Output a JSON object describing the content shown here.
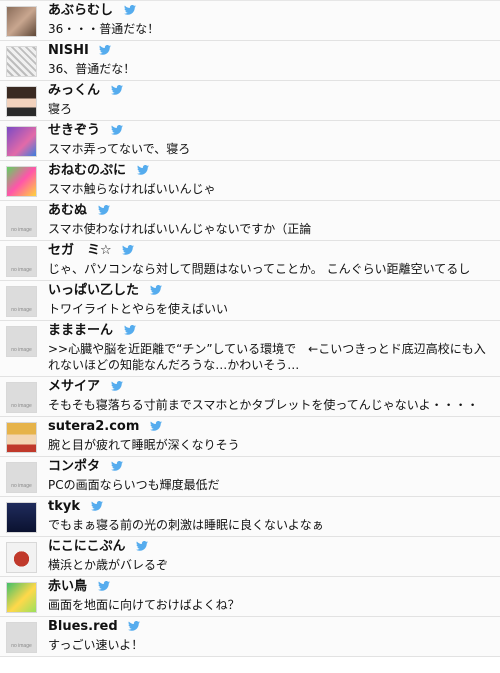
{
  "colors": {
    "bird": "#55acee"
  },
  "no_image_label": "no image",
  "comments": [
    {
      "name": "あぶらむし",
      "text": "36・・・普通だな！",
      "avatar": "a1"
    },
    {
      "name": "NISHI",
      "text": "36、普通だな！",
      "avatar": "a2"
    },
    {
      "name": "みっくん",
      "text": "寝ろ",
      "avatar": "a3"
    },
    {
      "name": "せきぞう",
      "text": "スマホ弄ってないで、寝ろ",
      "avatar": "a4"
    },
    {
      "name": "おねむのぷに",
      "text": "スマホ触らなければいいんじゃ",
      "avatar": "a5"
    },
    {
      "name": "あむぬ",
      "text": "スマホ使わなければいいんじゃないですか（正論",
      "avatar": "noimg"
    },
    {
      "name": "セガ　ミ☆",
      "text": "じゃ、パソコンなら対して問題はないってことか。 こんぐらい距離空いてるし",
      "avatar": "noimg"
    },
    {
      "name": "いっぱい乙した",
      "text": "トワイライトとやらを使えばいい",
      "avatar": "noimg"
    },
    {
      "name": "まままーん",
      "text": ">>心臓や脳を近距離で“チン”している環境で　←こいつきっとド底辺高校にも入れないほどの知能なんだろうな…かわいそう…",
      "avatar": "noimg",
      "tall": true
    },
    {
      "name": "メサイア",
      "text": "そもそも寝落ちる寸前までスマホとかタブレットを使ってんじゃないよ・・・・",
      "avatar": "noimg"
    },
    {
      "name": "sutera2.com",
      "text": "腕と目が疲れて睡眠が深くなりそう",
      "avatar": "a6"
    },
    {
      "name": "コンポタ",
      "text": "PCの画面ならいつも輝度最低だ",
      "avatar": "noimg"
    },
    {
      "name": "tkyk",
      "text": "でもまぁ寝る前の光の刺激は睡眠に良くないよなぁ",
      "avatar": "a7"
    },
    {
      "name": "にこにこぷん",
      "text": "横浜とか歳がバレるぞ",
      "avatar": "a8"
    },
    {
      "name": "赤い鳥",
      "text": "画面を地面に向けておけばよくね？",
      "avatar": "a9"
    },
    {
      "name": "Blues.red",
      "text": "すっごい速いよ！",
      "avatar": "noimg"
    }
  ]
}
